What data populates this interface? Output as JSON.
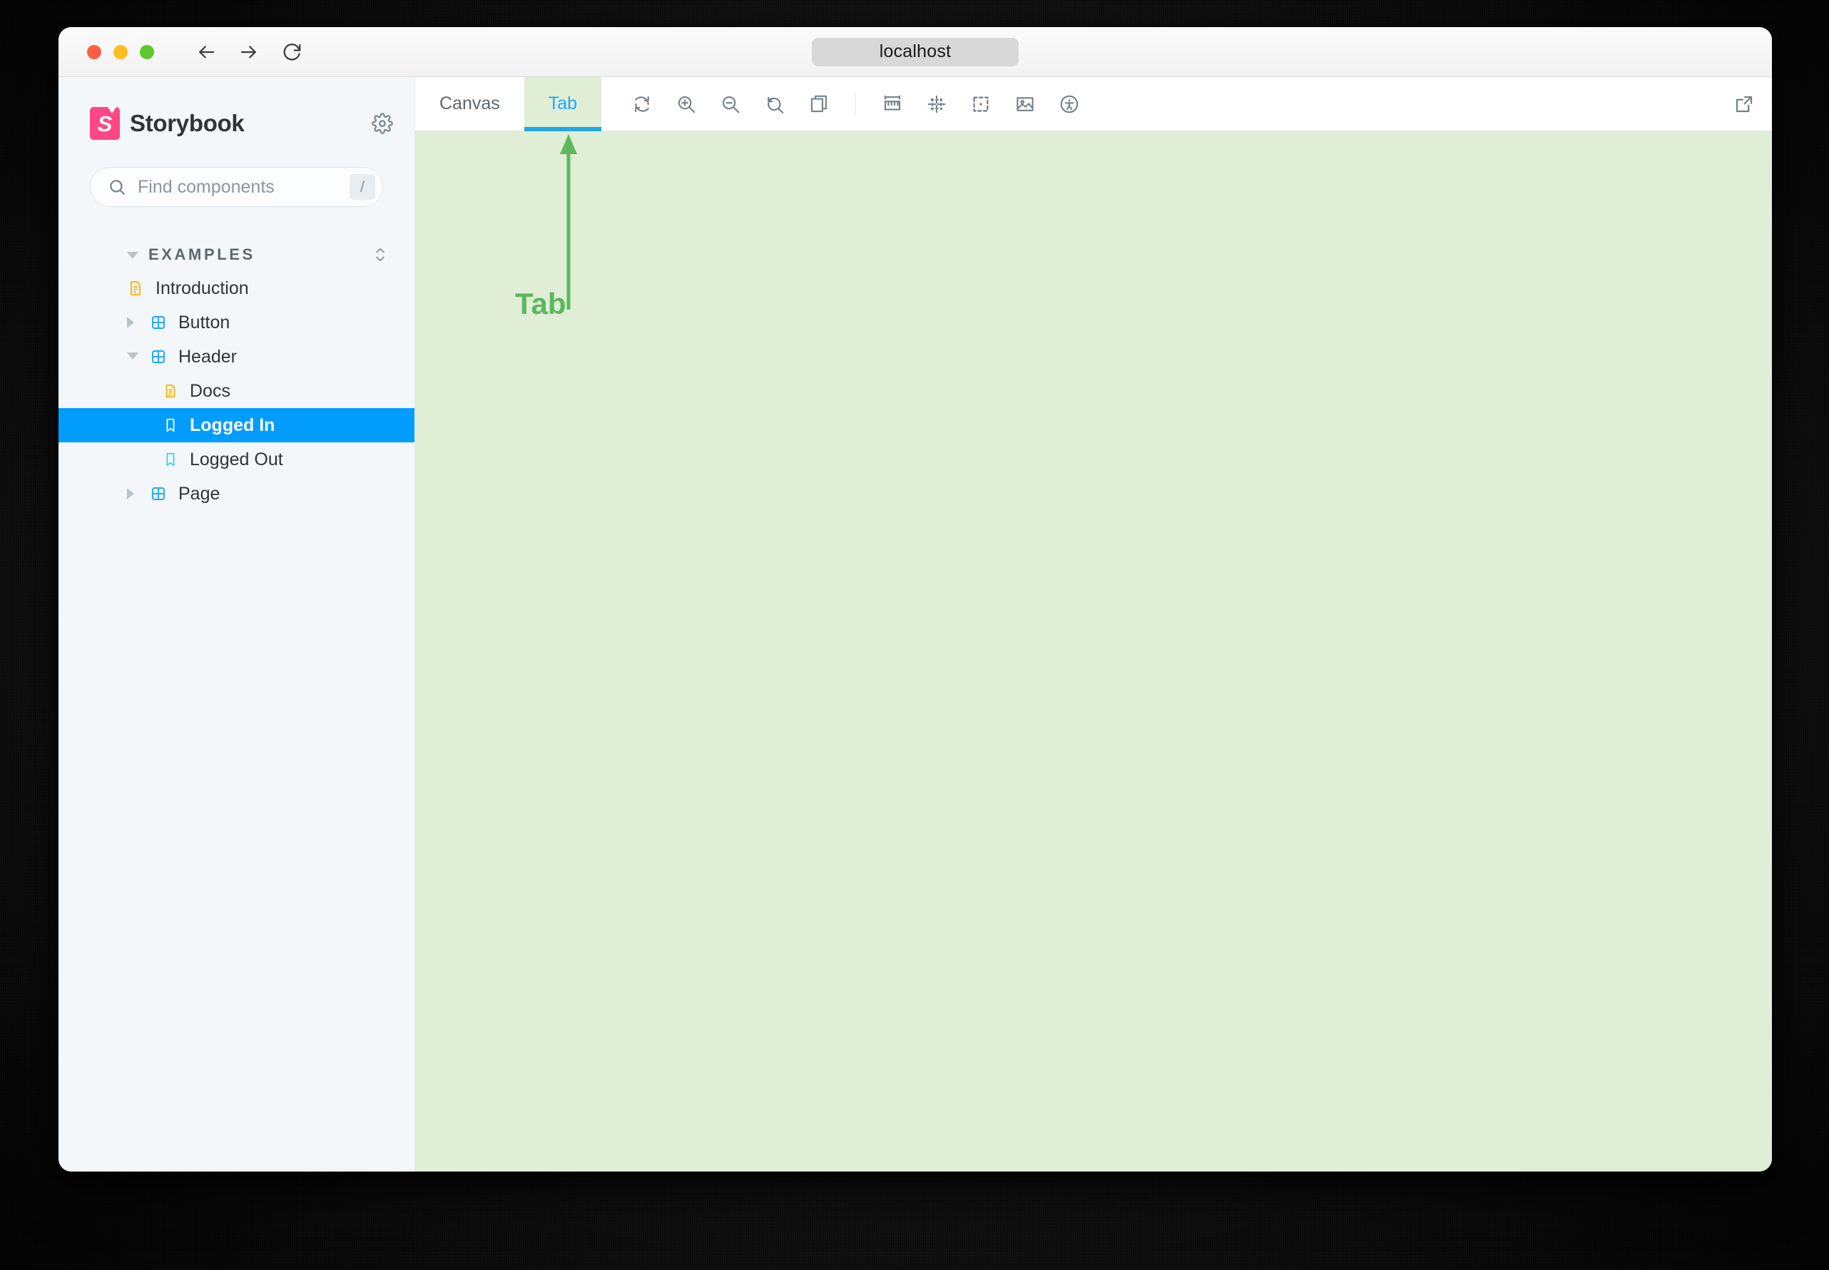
{
  "browser": {
    "url": "localhost",
    "traffic_lights": [
      "close-red",
      "minimize-yellow",
      "maximize-green"
    ],
    "nav": {
      "back": "back-arrow-icon",
      "forward": "forward-arrow-icon",
      "reload": "reload-icon"
    }
  },
  "sidebar": {
    "brand": "Storybook",
    "logo_letter": "S",
    "settings_icon": "gear-icon",
    "search": {
      "placeholder": "Find components",
      "value": "",
      "shortcut": "/",
      "icon": "search-icon"
    },
    "sections": [
      {
        "label": "EXAMPLES",
        "expanded": true,
        "sort_icon": "chevron-updown-icon"
      }
    ],
    "items": [
      {
        "label": "Introduction",
        "icon": "document-icon",
        "icon_color": "#FFAE00",
        "level": 0,
        "twisty": "none",
        "selected": false
      },
      {
        "label": "Button",
        "icon": "component-icon",
        "icon_color": "#1EA7FD",
        "level": 0,
        "twisty": "collapsed",
        "selected": false
      },
      {
        "label": "Header",
        "icon": "component-icon",
        "icon_color": "#1EA7FD",
        "level": 0,
        "twisty": "expanded",
        "selected": false
      },
      {
        "label": "Docs",
        "icon": "document-icon",
        "icon_color": "#FFAE00",
        "level": 1,
        "twisty": "none",
        "selected": false
      },
      {
        "label": "Logged In",
        "icon": "story-bookmark-icon",
        "icon_color": "#FFFFFF",
        "level": 1,
        "twisty": "none",
        "selected": true
      },
      {
        "label": "Logged Out",
        "icon": "story-bookmark-icon",
        "icon_color": "#37D5D3",
        "level": 1,
        "twisty": "none",
        "selected": false
      },
      {
        "label": "Page",
        "icon": "component-icon",
        "icon_color": "#1EA7FD",
        "level": 0,
        "twisty": "collapsed",
        "selected": false
      }
    ]
  },
  "toolbar": {
    "tabs": [
      {
        "label": "Canvas",
        "active": false
      },
      {
        "label": "Tab",
        "active": true
      }
    ],
    "tools_left": [
      "remount-icon",
      "zoom-in-icon",
      "zoom-out-icon",
      "zoom-reset-icon",
      "grid-stack-icon"
    ],
    "tools_right": [
      "measure-ruler-icon",
      "grid-dots-icon",
      "outline-icon",
      "background-image-icon",
      "accessibility-icon"
    ],
    "open_new_tab_icon": "open-in-new-icon"
  },
  "annotation": {
    "label": "Tab",
    "color": "#5CB85C",
    "arrow": "up-arrow-annotation"
  },
  "colors": {
    "accent_blue": "#029CFD",
    "tab_underline": "#1EA7E4",
    "canvas_green": "#DFEED4",
    "brand_pink": "#FF4785",
    "sidebar_bg": "#F4F7F9"
  }
}
